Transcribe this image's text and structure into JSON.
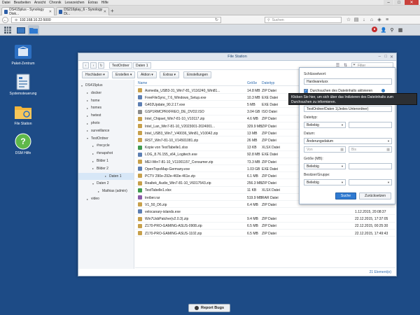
{
  "browser": {
    "menu": [
      "Datei",
      "Bearbeiten",
      "Ansicht",
      "Chronik",
      "Lesezeichen",
      "Extras",
      "Hilfe"
    ],
    "tabs": [
      {
        "label": "DS415plus - Synology Disk..."
      },
      {
        "label": "DS216play_6 - Synology Di..."
      }
    ],
    "url": "192.168.10.22:5000",
    "search_placeholder": "Suchen"
  },
  "desktop": {
    "icons": [
      {
        "label": "Paket-Zentrum",
        "icon": "package-center-icon"
      },
      {
        "label": "Systemsteuerung",
        "icon": "control-panel-icon"
      },
      {
        "label": "File Station",
        "icon": "file-station-icon"
      },
      {
        "label": "DSM Hilfe",
        "icon": "help-icon"
      }
    ]
  },
  "file_station": {
    "title": "File Station",
    "breadcrumb": [
      "TestOrdner",
      "Daten 1"
    ],
    "filter_placeholder": "Filter",
    "toolbar": [
      "Hochladen",
      "Erstellen",
      "Aktion",
      "Extras",
      "Einstellungen"
    ],
    "tree": [
      {
        "label": "DS415plus",
        "level": 0,
        "expanded": true
      },
      {
        "label": "docker",
        "level": 1
      },
      {
        "label": "home",
        "level": 1
      },
      {
        "label": "homes",
        "level": 1
      },
      {
        "label": "hwtest",
        "level": 1
      },
      {
        "label": "photo",
        "level": 1
      },
      {
        "label": "surveillance",
        "level": 1
      },
      {
        "label": "TestOrdner",
        "level": 1,
        "expanded": true
      },
      {
        "label": "#recycle",
        "level": 2
      },
      {
        "label": "#snapshot",
        "level": 2
      },
      {
        "label": "Bilder 1",
        "level": 2
      },
      {
        "label": "Bilder 2",
        "level": 2
      },
      {
        "label": "Daten 1",
        "level": 2,
        "selected": true
      },
      {
        "label": "Daten 2",
        "level": 2,
        "expanded": true
      },
      {
        "label": "Mathias (admin)",
        "level": 3
      },
      {
        "label": "video",
        "level": 1
      }
    ],
    "columns": {
      "name": "Name",
      "size": "Größe",
      "type": "Dateityp"
    },
    "files": [
      {
        "name": "Asmedia_USB3-31_Win7-81_V116240_Win81...",
        "size": "14.8 MB",
        "type": "ZIP Datei",
        "date": "",
        "color": "#c7a04b"
      },
      {
        "name": "FreeFileSync_7.6_Windows_Setup.exe",
        "size": "10.3 MB",
        "type": "EXE Datei",
        "date": "",
        "color": "#5d7fb3"
      },
      {
        "name": "G402Update_90.2.17.exe",
        "size": "5 MB",
        "type": "EXE Datei",
        "date": "",
        "color": "#5d7fb3"
      },
      {
        "name": "GSP1RMCPRXFREO_DE_DVD2.ISO",
        "size": "3.04 GB",
        "type": "ISO Datei",
        "date": "",
        "color": "#8b8b8b"
      },
      {
        "name": "Intel_Chipset_Win7-81-10_V10117.zip",
        "size": "4.6 MB",
        "type": "ZIP Datei",
        "date": "",
        "color": "#c7a04b"
      },
      {
        "name": "Intel_Lan_Win7-81-10_V2023001-2024001...",
        "size": "329.9 MB",
        "type": "ZIP Datei",
        "date": "",
        "color": "#c7a04b"
      },
      {
        "name": "Intel_USB3_Win7_V40036_Win81_V10042.zip",
        "size": "13 MB",
        "type": "ZIP Datei",
        "date": "",
        "color": "#c7a04b"
      },
      {
        "name": "IRST_Win7-81-10_V14501081.zip",
        "size": "26 MB",
        "type": "ZIP Datei",
        "date": "",
        "color": "#c7a04b"
      },
      {
        "name": "Kopie von TestTabelle1.xlsx",
        "size": "13 KB",
        "type": "XLSX Datei",
        "date": "",
        "color": "#3f9a4f"
      },
      {
        "name": "LOG_8.76.155_x64_Logitech.exe",
        "size": "92.8 MB",
        "type": "EXE Datei",
        "date": "",
        "color": "#5d7fb3"
      },
      {
        "name": "MEI-Win7-81-10_V11001157_Consumer.zip",
        "size": "73.3 MB",
        "type": "ZIP Datei",
        "date": "",
        "color": "#c7a04b"
      },
      {
        "name": "OpenTopoMap-Germany.exe",
        "size": "1.03 GB",
        "type": "EXE Datei",
        "date": "",
        "color": "#5d7fb3"
      },
      {
        "name": "PCTV 290e-292e-460e-461e.zip",
        "size": "6.1 MB",
        "type": "ZIP Datei",
        "date": "",
        "color": "#c7a04b"
      },
      {
        "name": "Realtek_Audio_Win7-81-10_V6017543.zip",
        "size": "256.3 MB",
        "type": "ZIP Datei",
        "date": "",
        "color": "#c7a04b"
      },
      {
        "name": "TestTabelle1.xlsx",
        "size": "11 KB",
        "type": "XLSX Datei",
        "date": "",
        "color": "#3f9a4f"
      },
      {
        "name": "treiber.rar",
        "size": "519.9 MB",
        "type": "RAR Datei",
        "date": "",
        "color": "#8a5ba8"
      },
      {
        "name": "V1_50_D6.zip",
        "size": "6.4 MB",
        "type": "ZIP Datei",
        "date": "",
        "color": "#c7a04b"
      },
      {
        "name": "velocanary-islands.exe",
        "size": "",
        "type": "",
        "date": "1.12.2015, 20:08:37",
        "color": "#5d7fb3"
      },
      {
        "name": "Win7UsbPatcher(v2.0.3).zip",
        "size": "9.4 MB",
        "type": "ZIP Datei",
        "date": "22.12.2015, 17:37:05",
        "color": "#c7a04b"
      },
      {
        "name": "Z170-PRO-GAMING-ASUS-0908.zip",
        "size": "6.5 MB",
        "type": "ZIP Datei",
        "date": "22.12.2015, 00:25:30",
        "color": "#c7a04b"
      },
      {
        "name": "Z170-PRO-GAMING-ASUS-1102.zip",
        "size": "6.5 MB",
        "type": "ZIP Datei",
        "date": "22.12.2015, 17:49:43",
        "color": "#c7a04b"
      }
    ],
    "status": "21 Element(e)"
  },
  "search_panel": {
    "keyword_label": "Schlüsselwort:",
    "keyword_value": "Hardwareluxx",
    "content_search_label": "Durchsuchen des Dateiinhalts aktivieren",
    "tooltip": "Klicken Sie hier, um sich über das Indizieren des Dateiinhalts zum Durchsuchen zu informieren.",
    "location_value": "TestOrdner/Daten 1(Jedes Unterordner)",
    "filetype_label": "Dateityp:",
    "filetype_value": "Beliebig",
    "date_label": "Datum:",
    "date_value": "Änderungsdatum",
    "date_from_placeholder": "Von",
    "date_to_placeholder": "Bis",
    "size_label": "Größe (MB):",
    "size_value": "Beliebig",
    "owner_label": "Besitzer/Gruppe:",
    "owner_value": "Beliebig",
    "search_button": "Suche",
    "reset_button": "Zurücksetzen"
  },
  "report_bugs": "Report Bugs",
  "colors": {
    "accent": "#2f7ad1",
    "desktop": "#1d4b86",
    "selection": "#d7e7f7"
  }
}
